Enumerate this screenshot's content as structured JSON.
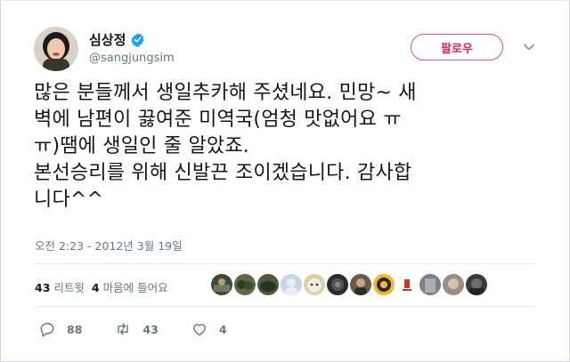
{
  "user": {
    "display_name": "심상정",
    "handle": "@sangjungsim",
    "verified_icon": "verified-badge-icon"
  },
  "follow_button": {
    "label": "팔로우"
  },
  "tweet": {
    "text": "많은 분들께서 생일추카해 주셨네요. 민망~ 새\n벽에 남편이 끓여준 미역국(엄청 맛없어요 ㅠ\nㅠ)땜에 생일인 줄 알았죠.\n본선승리를 위해 신발끈 조이겠습니다. 감사합\n니다^^",
    "timestamp": "오전 2:23 - 2012년 3월 19일"
  },
  "stats": {
    "retweets_count": "43",
    "retweets_label": "리트윗",
    "likes_count": "4",
    "likes_label": "마음에 들어요"
  },
  "actions": {
    "reply_count": "88",
    "retweet_count": "43",
    "like_count": "4"
  },
  "colors": {
    "follow_accent": "#e0245e",
    "verified_blue": "#1da1f2",
    "muted_text": "#657786"
  }
}
